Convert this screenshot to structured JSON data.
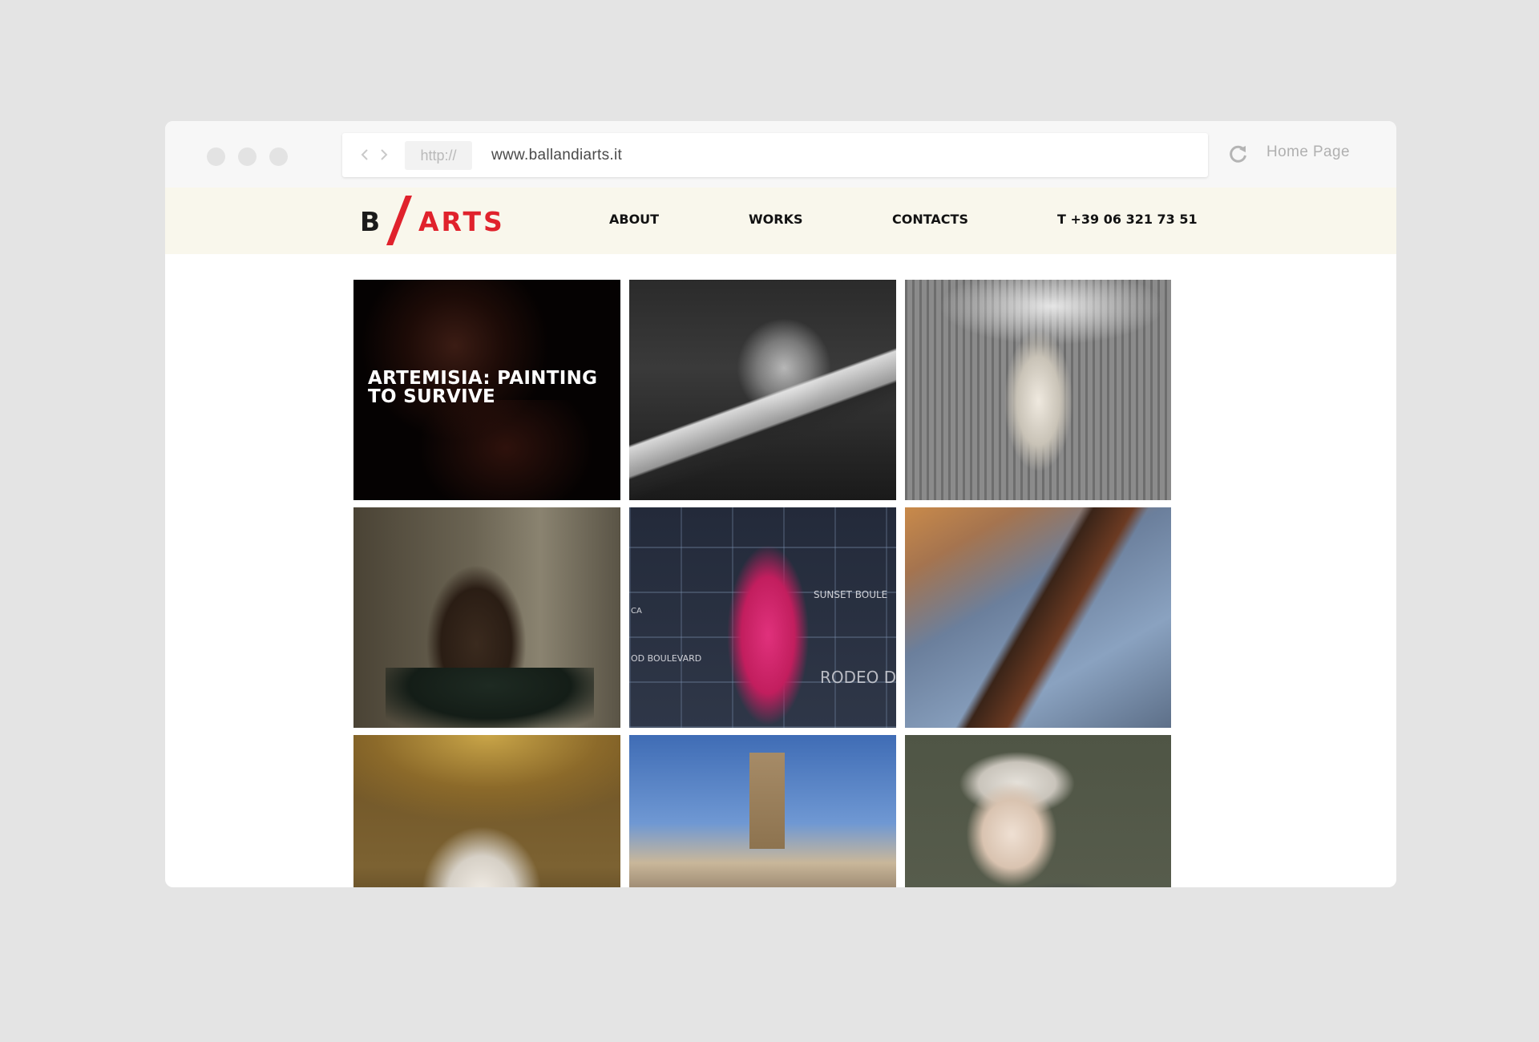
{
  "browser": {
    "protocol": "http://",
    "url": "www.ballandiarts.it",
    "home_label": "Home Page"
  },
  "site": {
    "logo": {
      "left": "B",
      "right": "ARTS"
    },
    "nav": {
      "about": "ABOUT",
      "works": "WORKS",
      "contacts": "CONTACTS",
      "phone": "T +39 06 321 73 51"
    },
    "accent_color": "#e0222c",
    "header_bg": "#f9f7ec"
  },
  "gallery": {
    "tiles": [
      {
        "title": "ARTEMISIA: PAINTING TO SURVIVE"
      },
      {
        "title": ""
      },
      {
        "title": ""
      },
      {
        "title": ""
      },
      {
        "title": "",
        "signs": [
          "SUNSET BOULE",
          "CA",
          "OD BOULEVARD",
          "RODEO D"
        ]
      },
      {
        "title": ""
      },
      {
        "title": ""
      },
      {
        "title": ""
      },
      {
        "title": ""
      }
    ]
  }
}
